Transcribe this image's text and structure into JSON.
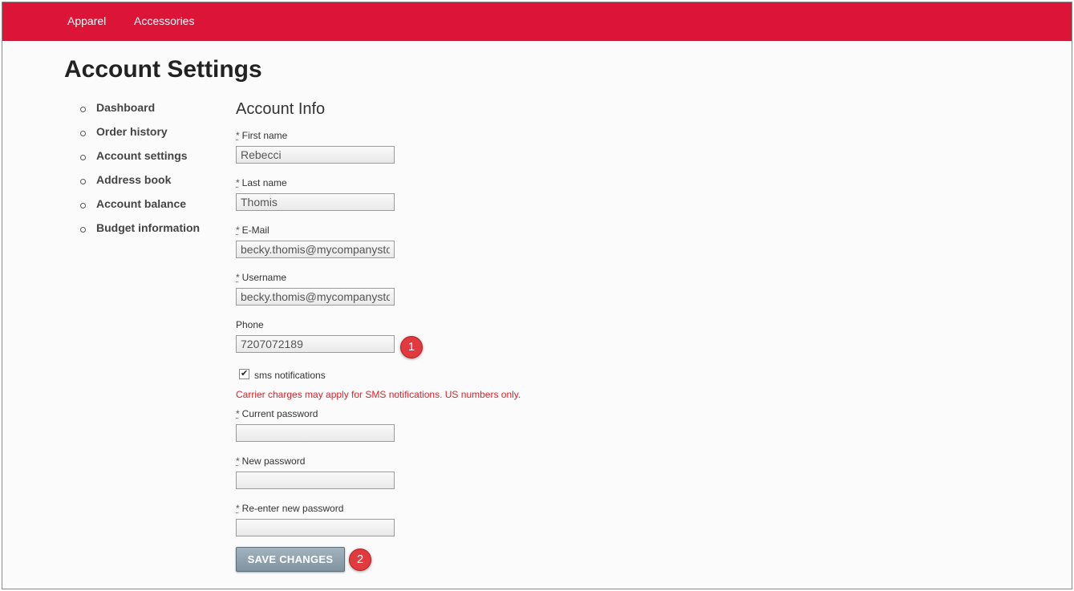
{
  "topnav": {
    "items": [
      "Apparel",
      "Accessories"
    ]
  },
  "page_title": "Account Settings",
  "sidebar": {
    "items": [
      "Dashboard",
      "Order history",
      "Account settings",
      "Address book",
      "Account balance",
      "Budget information"
    ]
  },
  "form": {
    "section_title": "Account Info",
    "required_marker": "*",
    "first_name": {
      "label": "First name",
      "value": "Rebecci"
    },
    "last_name": {
      "label": "Last name",
      "value": "Thomis"
    },
    "email": {
      "label": "E-Mail",
      "value": "becky.thomis@mycompanystore.com"
    },
    "username": {
      "label": "Username",
      "value": "becky.thomis@mycompanystore.com"
    },
    "phone": {
      "label": "Phone",
      "value": "7207072189"
    },
    "sms": {
      "label": "sms notifications",
      "checked": true,
      "check_glyph": "✔"
    },
    "sms_warning": "Carrier charges may apply for SMS notifications. US numbers only.",
    "current_password": {
      "label": "Current password"
    },
    "new_password": {
      "label": "New password"
    },
    "reenter_password": {
      "label": "Re-enter new password"
    },
    "save_label": "SAVE CHANGES"
  },
  "callouts": [
    "1",
    "2"
  ],
  "colors": {
    "brand_red": "#dc1437",
    "warning_red": "#d9232a",
    "button_gray_blue": "#8c9fab",
    "callout_red": "#e03a3e"
  }
}
